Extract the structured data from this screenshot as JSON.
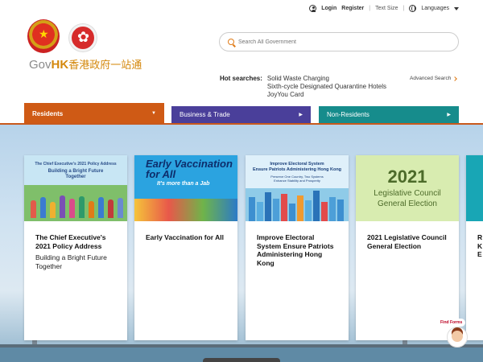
{
  "header": {
    "login": "Login",
    "register": "Register",
    "separator": "|",
    "text_size": "Text Size",
    "languages": "Languages",
    "logo": {
      "en_gov": "Gov",
      "en_hk": "HK",
      "zh": "香港政府",
      "zh_accent": "一站通"
    }
  },
  "search": {
    "placeholder": "Search All Government"
  },
  "hot_searches": {
    "label": "Hot searches:",
    "items": [
      "Solid Waste Charging",
      "Sixth-cycle Designated Quarantine Hotels",
      "JoyYou Card"
    ],
    "advanced": "Advanced Search"
  },
  "tabs": [
    {
      "label": "Residents",
      "arrow": "▼",
      "color": "#cf5a15"
    },
    {
      "label": "Business & Trade",
      "arrow": "▶",
      "color": "#4a3f9a"
    },
    {
      "label": "Non-Residents",
      "arrow": "▶",
      "color": "#168c8c"
    }
  ],
  "cards": [
    {
      "image_text": [
        "The Chief Executive's 2021 Policy Address",
        "Building a Bright Future",
        "Together"
      ],
      "title": "The Chief Executive's 2021 Policy Address",
      "subtitle": "Building a Bright Future Together"
    },
    {
      "image_text": [
        "Early Vaccination for All",
        "It's more than a Jab"
      ],
      "title": "Early Vaccination for All",
      "subtitle": ""
    },
    {
      "image_text": [
        "Improve Electoral System",
        "Ensure Patriots Administering Hong Kong",
        "Preserve One Country, Two Systems",
        "Enhance Stability and Prosperity"
      ],
      "title": "Improve Electoral System    Ensure Patriots Administering Hong Kong",
      "subtitle": ""
    },
    {
      "image_text": [
        "2021",
        "Legislative Council",
        "General Election"
      ],
      "title": "2021 Legislative Council General Election",
      "subtitle": ""
    },
    {
      "image_text": [],
      "title": "R K E",
      "subtitle": ""
    }
  ],
  "find_forms": "Find Forms"
}
